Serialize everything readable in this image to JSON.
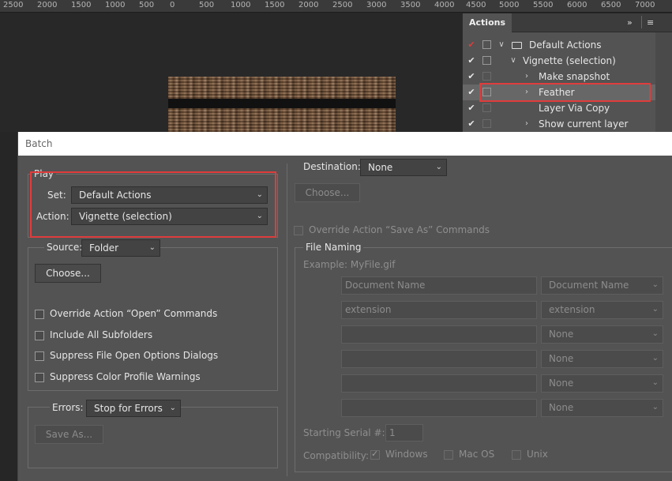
{
  "ruler": {
    "labels": [
      "2500",
      "2000",
      "1500",
      "1000",
      "500",
      "0",
      "500",
      "1000",
      "1500",
      "2000",
      "2500",
      "3000",
      "3500",
      "4000",
      "4500",
      "5000",
      "5500",
      "6000",
      "6500",
      "7000"
    ]
  },
  "actions_panel": {
    "tab_label": "Actions",
    "collapse_icon": "double-chevron-right-icon",
    "menu_icon": "hamburger-menu-icon",
    "rows": [
      {
        "label": "Default Actions",
        "check_color": "#e03c3c"
      },
      {
        "label": "Vignette (selection)"
      },
      {
        "label": "Make snapshot"
      },
      {
        "label": "Feather"
      },
      {
        "label": "Layer Via Copy"
      },
      {
        "label": "Show current layer"
      }
    ]
  },
  "dialog": {
    "title": "Batch",
    "play": {
      "legend": "Play",
      "set_label": "Set:",
      "set_value": "Default Actions",
      "action_label": "Action:",
      "action_value": "Vignette (selection)"
    },
    "source": {
      "label": "Source:",
      "value": "Folder",
      "choose_button": "Choose...",
      "checkboxes": [
        "Override Action “Open” Commands",
        "Include All Subfolders",
        "Suppress File Open Options Dialogs",
        "Suppress Color Profile Warnings"
      ]
    },
    "errors": {
      "label": "Errors:",
      "value": "Stop for Errors",
      "save_as_button": "Save As..."
    },
    "destination": {
      "label": "Destination:",
      "value": "None",
      "choose_button": "Choose...",
      "override_save_as": "Override Action “Save As” Commands"
    },
    "file_naming": {
      "legend": "File Naming",
      "example": "Example: MyFile.gif",
      "rows": [
        {
          "field": "Document Name",
          "select": "Document Name"
        },
        {
          "field": "extension",
          "select": "extension"
        },
        {
          "field": "",
          "select": "None"
        },
        {
          "field": "",
          "select": "None"
        },
        {
          "field": "",
          "select": "None"
        },
        {
          "field": "",
          "select": "None"
        }
      ],
      "serial_label": "Starting Serial #:",
      "serial_value": "1",
      "compat_label": "Compatibility:",
      "compat_windows": "Windows",
      "compat_macos": "Mac OS",
      "compat_unix": "Unix"
    }
  }
}
